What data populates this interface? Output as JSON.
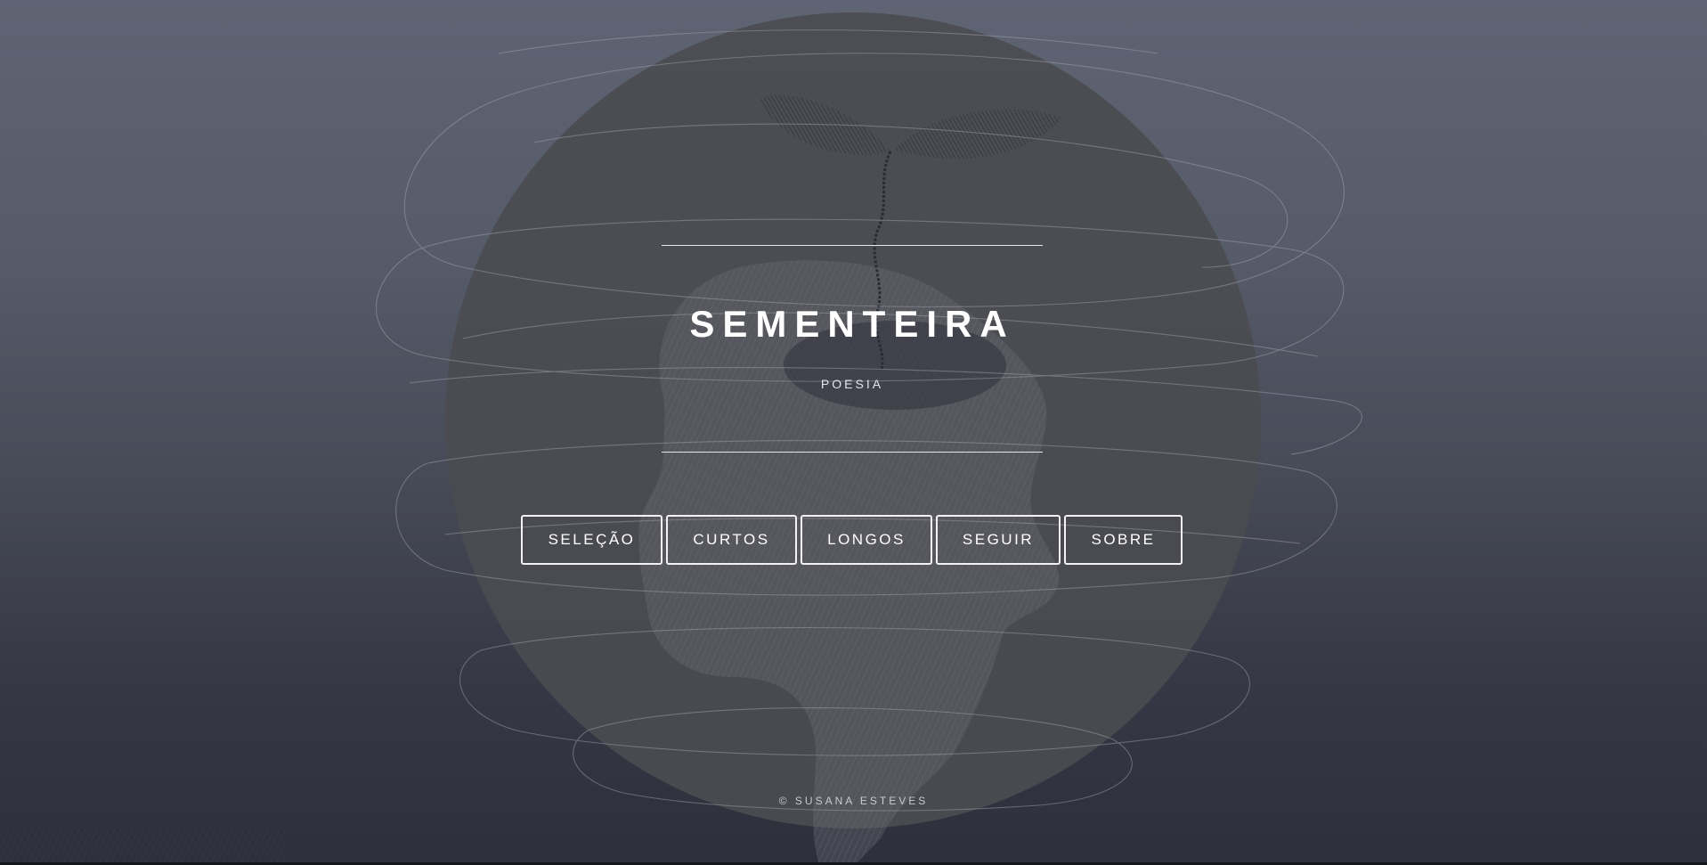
{
  "site": {
    "title": "SEMENTEIRA",
    "subtitle": "POESIA"
  },
  "nav": {
    "items": [
      {
        "label": "SELEÇÃO"
      },
      {
        "label": "CURTOS"
      },
      {
        "label": "LONGOS"
      },
      {
        "label": "SEGUIR"
      },
      {
        "label": "SOBRE"
      }
    ]
  },
  "footer": {
    "copyright": "© SUSANA ESTEVES"
  },
  "colors": {
    "background_top": "#5e6473",
    "background_bottom": "#2d2f3b",
    "circle": "#4b4c50",
    "text": "#ffffff",
    "button_border": "#f2f2f4"
  },
  "icons": {
    "background": "head-with-sprout-illustration"
  }
}
